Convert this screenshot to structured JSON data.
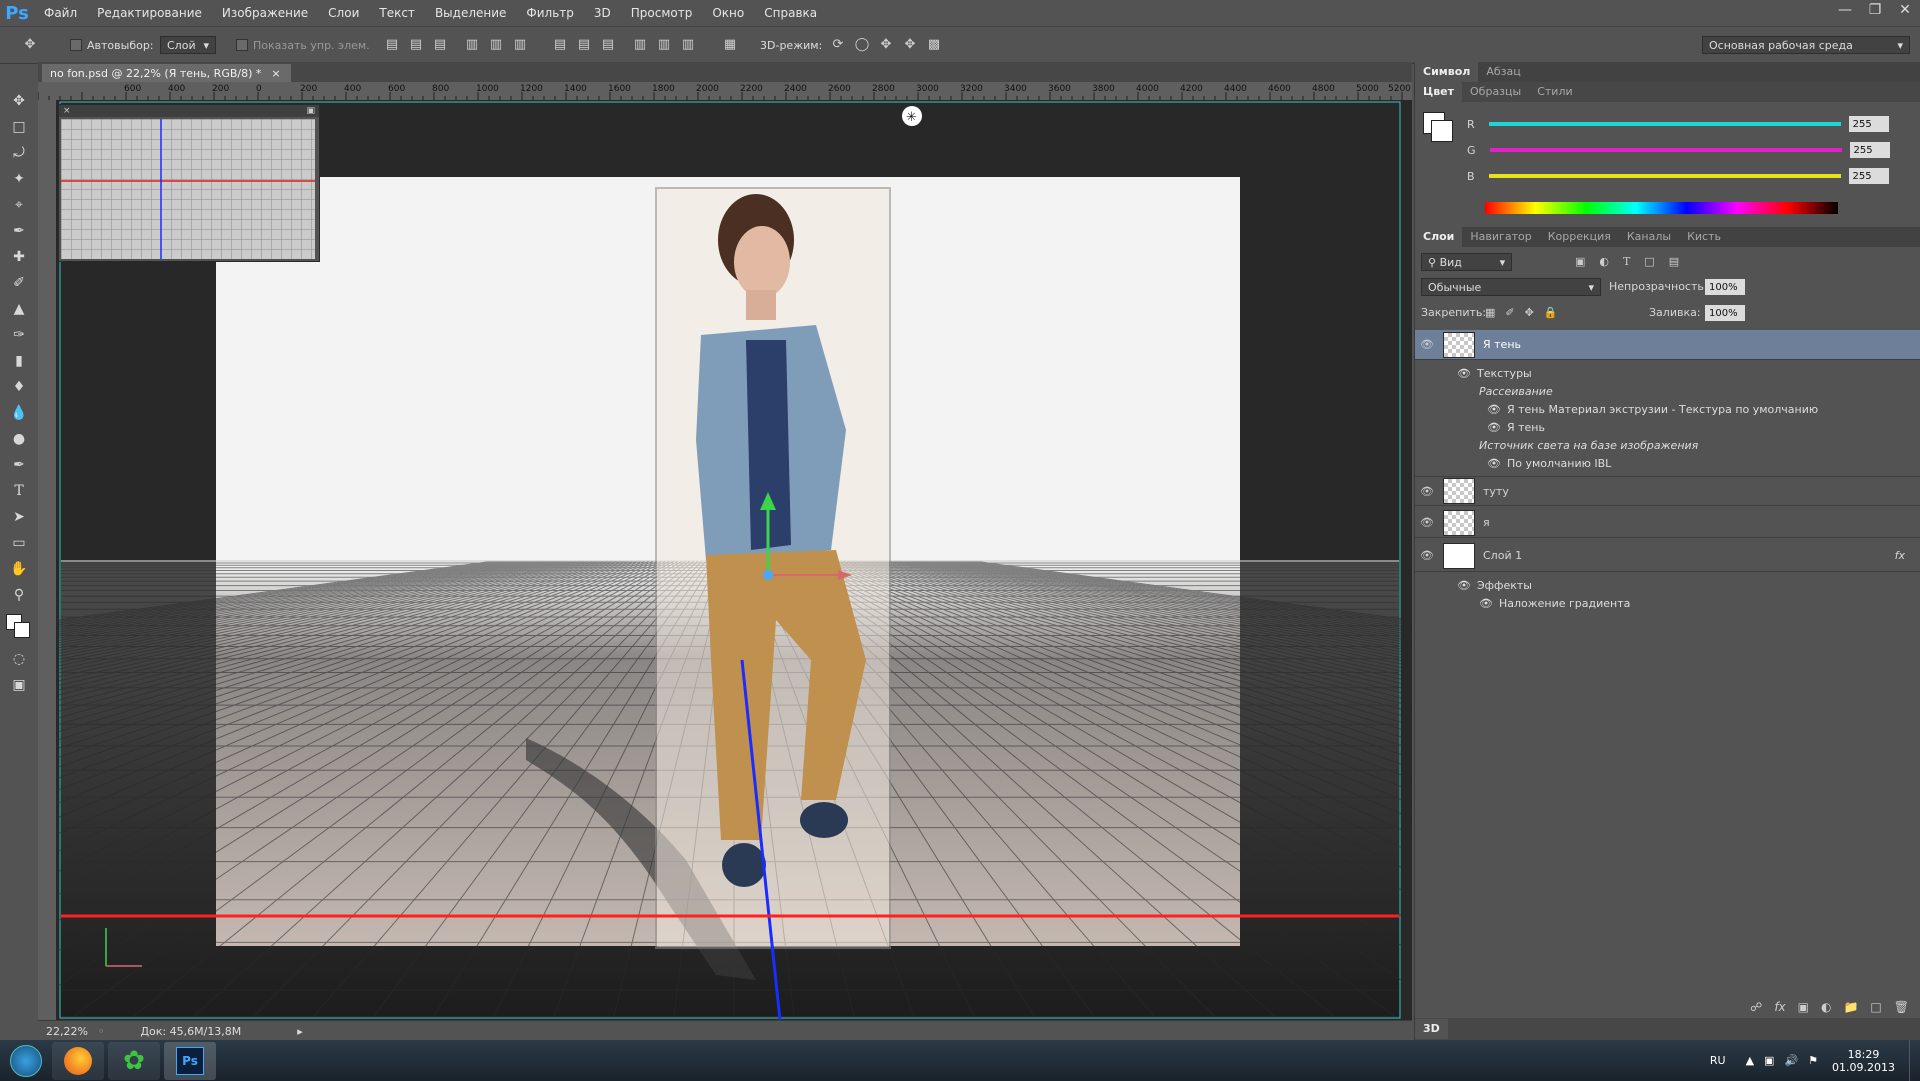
{
  "app": {
    "logo": "Ps"
  },
  "menu": [
    "Файл",
    "Редактирование",
    "Изображение",
    "Слои",
    "Текст",
    "Выделение",
    "Фильтр",
    "3D",
    "Просмотр",
    "Окно",
    "Справка"
  ],
  "window_controls": [
    "minimize-icon",
    "restore-icon",
    "close-icon"
  ],
  "options": {
    "autoselect_label": "Автовыбор:",
    "autoselect_value": "Слой",
    "show_controls_label": "Показать упр. элем.",
    "mode3d_label": "3D-режим:",
    "workspace": "Основная рабочая среда"
  },
  "document": {
    "tab_title": "no fon.psd @ 22,2% (Я тень, RGB/8) *",
    "ruler_labels": [
      "600",
      "400",
      "200",
      "0",
      "200",
      "400",
      "600",
      "800",
      "1000",
      "1200",
      "1400",
      "1600",
      "1800",
      "2000",
      "2200",
      "2400",
      "2600",
      "2800",
      "3000",
      "3200",
      "3400",
      "3600",
      "3800",
      "4000",
      "4200",
      "4400",
      "4600",
      "4800",
      "5000",
      "5200"
    ]
  },
  "status": {
    "zoom": "22,22%",
    "doc": "Док: 45,6M/13,8M"
  },
  "color_panel": {
    "tabs_top": [
      "Символ",
      "Абзац"
    ],
    "tabs": [
      "Цвет",
      "Образцы",
      "Стили"
    ],
    "channels": [
      {
        "label": "R",
        "value": "255",
        "color": "#1fd6d6"
      },
      {
        "label": "G",
        "value": "255",
        "color": "#e21fc8"
      },
      {
        "label": "B",
        "value": "255",
        "color": "#e8e21a"
      }
    ]
  },
  "layers_panel": {
    "tabs": [
      "Слои",
      "Навигатор",
      "Коррекция",
      "Каналы",
      "Кисть"
    ],
    "filter": "Вид",
    "blend_mode": "Обычные",
    "opacity_label": "Непрозрачность:",
    "opacity": "100%",
    "lock_label": "Закрепить:",
    "fill_label": "Заливка:",
    "fill": "100%",
    "layers": [
      {
        "name": "Я тень",
        "selected": true
      },
      {
        "name": "туту",
        "selected": false
      },
      {
        "name": "я",
        "selected": false
      },
      {
        "name": "Слой 1",
        "selected": false,
        "fx": "fx"
      }
    ],
    "sub_items": {
      "textures": "Текстуры",
      "diffuse": "Рассеивание",
      "material": "Я тень Материал экструзии - Текстура по умолчанию",
      "shadow": "Я тень",
      "ibl_source": "Источник света на базе изображения",
      "ibl_default": "По умолчанию IBL",
      "effects": "Эффекты",
      "gradient_overlay": "Наложение градиента"
    },
    "bottom_tab": "3D"
  },
  "taskbar": {
    "lang": "RU",
    "time": "18:29",
    "date": "01.09.2013",
    "apps": [
      "windows-start-icon",
      "firefox-icon",
      "icq-icon",
      "photoshop-icon"
    ],
    "ps_label": "Ps"
  }
}
